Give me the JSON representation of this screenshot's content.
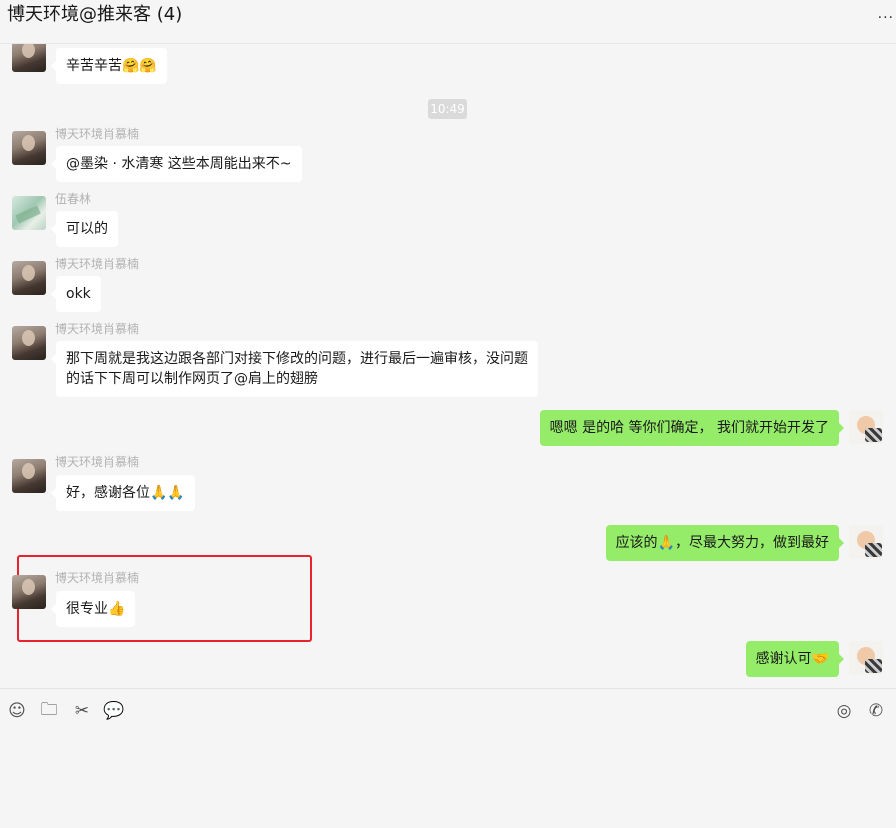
{
  "window": {
    "title": "博天环境@推来客 (4)",
    "more_label": "..."
  },
  "timestamp": "10:49",
  "messages": [
    {
      "sender": "",
      "text": "辛苦辛苦🤗🤗"
    },
    {
      "sender": "博天环境肖慕楠",
      "text": "@墨染 · 水清寒 这些本周能出来不~"
    },
    {
      "sender": "伍春林",
      "text": "可以的"
    },
    {
      "sender": "博天环境肖慕楠",
      "text": "okk"
    },
    {
      "sender": "博天环境肖慕楠",
      "lines": [
        "那下周就是我这边跟各部门对接下修改的问题，进行最后一遍审核，没问题",
        "的话下下周可以制作网页了@肩上的翅膀"
      ]
    },
    {
      "sender": "me",
      "text": "嗯嗯  是的哈 等你们确定， 我们就开始开发了"
    },
    {
      "sender": "博天环境肖慕楠",
      "text": "好，感谢各位🙏🙏"
    },
    {
      "sender": "me",
      "text": "应该的🙏，尽最大努力，做到最好"
    },
    {
      "sender": "博天环境肖慕楠",
      "text": "很专业👍"
    },
    {
      "sender": "me",
      "text": "感谢认可🤝"
    }
  ],
  "toolbar": {
    "emoji_icon": "☺",
    "folder_icon": "🗀",
    "scissors_icon": "✂",
    "chat_icon": "💬",
    "live_icon": "◎",
    "call_icon": "✆"
  },
  "colors": {
    "incoming_bubble": "#ffffff",
    "outgoing_bubble": "#95ec69",
    "highlight_border": "#e8232d",
    "background": "#f5f5f5"
  }
}
